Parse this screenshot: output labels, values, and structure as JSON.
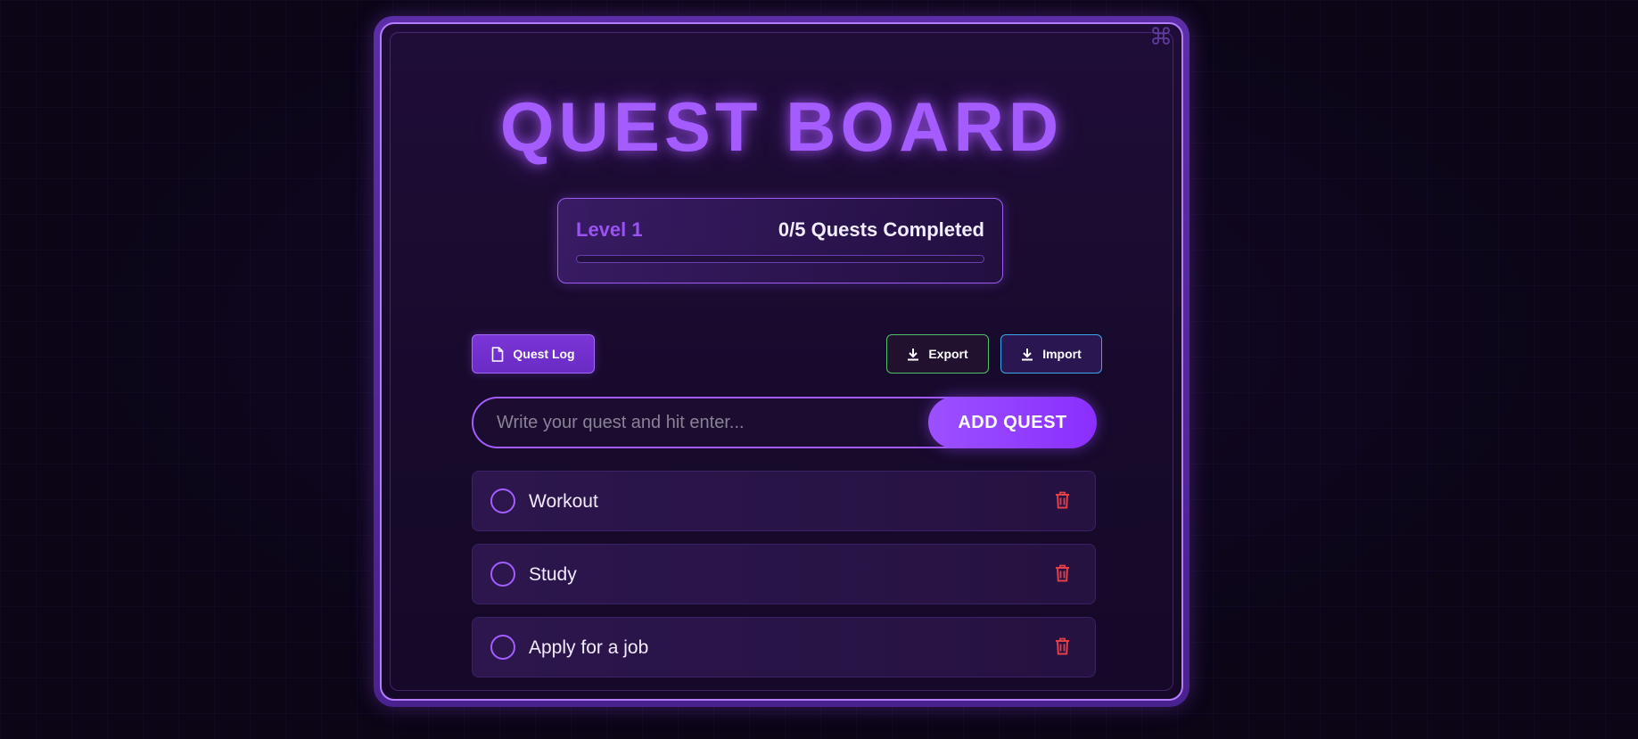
{
  "app": {
    "title": "QUEST BOARD",
    "corner_icon": "command-icon"
  },
  "progress": {
    "level_label": "Level 1",
    "completed_text": "0/5 Quests Completed",
    "completed": 0,
    "total": 5,
    "fraction": 0
  },
  "toolbar": {
    "quest_log_label": "Quest Log",
    "quest_log_icon": "document-icon",
    "export_label": "Export",
    "export_icon": "download-icon",
    "import_label": "Import",
    "import_icon": "download-icon"
  },
  "input": {
    "placeholder": "Write your quest and hit enter...",
    "value": "",
    "add_button_label": "ADD QUEST"
  },
  "quests": [
    {
      "text": "Workout",
      "completed": false
    },
    {
      "text": "Study",
      "completed": false
    },
    {
      "text": "Apply for a job",
      "completed": false
    }
  ],
  "colors": {
    "accent": "#a45cff",
    "delete": "#e0404a",
    "export_border": "#4fbf6a",
    "import_border": "#3aa8e8"
  }
}
